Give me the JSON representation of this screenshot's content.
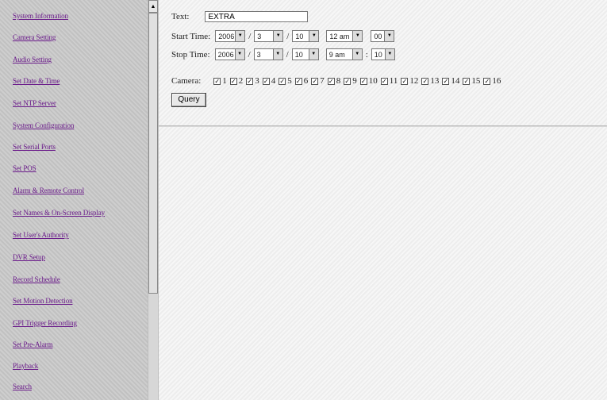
{
  "sidebar": {
    "items": [
      {
        "label": "System Information"
      },
      {
        "label": "Camera Setting"
      },
      {
        "label": "Audio Setting"
      },
      {
        "label": "Set Date & Time"
      },
      {
        "label": "Set NTP Server"
      },
      {
        "label": "System Configuration"
      },
      {
        "label": "Set Serial Ports"
      },
      {
        "label": "Set POS"
      },
      {
        "label": "Alarm & Remote Control"
      },
      {
        "label": "Set Names & On-Screen Display"
      },
      {
        "label": "Set User's Authority"
      },
      {
        "label": "DVR Setup"
      },
      {
        "label": "Record Schedule"
      },
      {
        "label": "Set Motion Detection"
      },
      {
        "label": "GPI Trigger Recording"
      },
      {
        "label": "Set Pre-Alarm"
      },
      {
        "label": "Playback"
      },
      {
        "label": "Search"
      }
    ]
  },
  "form": {
    "text_label": "Text:",
    "text_value": "EXTRA",
    "start_label": "Start Time:",
    "start": {
      "year": "2006",
      "month": "3",
      "day": "10",
      "hour": "12 am",
      "minute": "00"
    },
    "stop_label": "Stop Time:",
    "stop": {
      "year": "2006",
      "month": "3",
      "day": "10",
      "hour": "9 am",
      "minute": "10"
    },
    "date_sep": "/",
    "time_sep": ":",
    "camera_label": "Camera:",
    "cameras": [
      "1",
      "2",
      "3",
      "4",
      "5",
      "6",
      "7",
      "8",
      "9",
      "10",
      "11",
      "12",
      "13",
      "14",
      "15",
      "16"
    ],
    "checked_glyph": "✓",
    "query_label": "Query"
  },
  "icons": {
    "scroll_up": "scroll-up-arrow-icon",
    "dropdown": "dropdown-arrow-icon",
    "checkbox": "checkmark-icon"
  },
  "colors": {
    "link": "#6a1a8a",
    "sidebar_bg": "#c9c9c9",
    "main_bg": "#f1f1f1"
  }
}
